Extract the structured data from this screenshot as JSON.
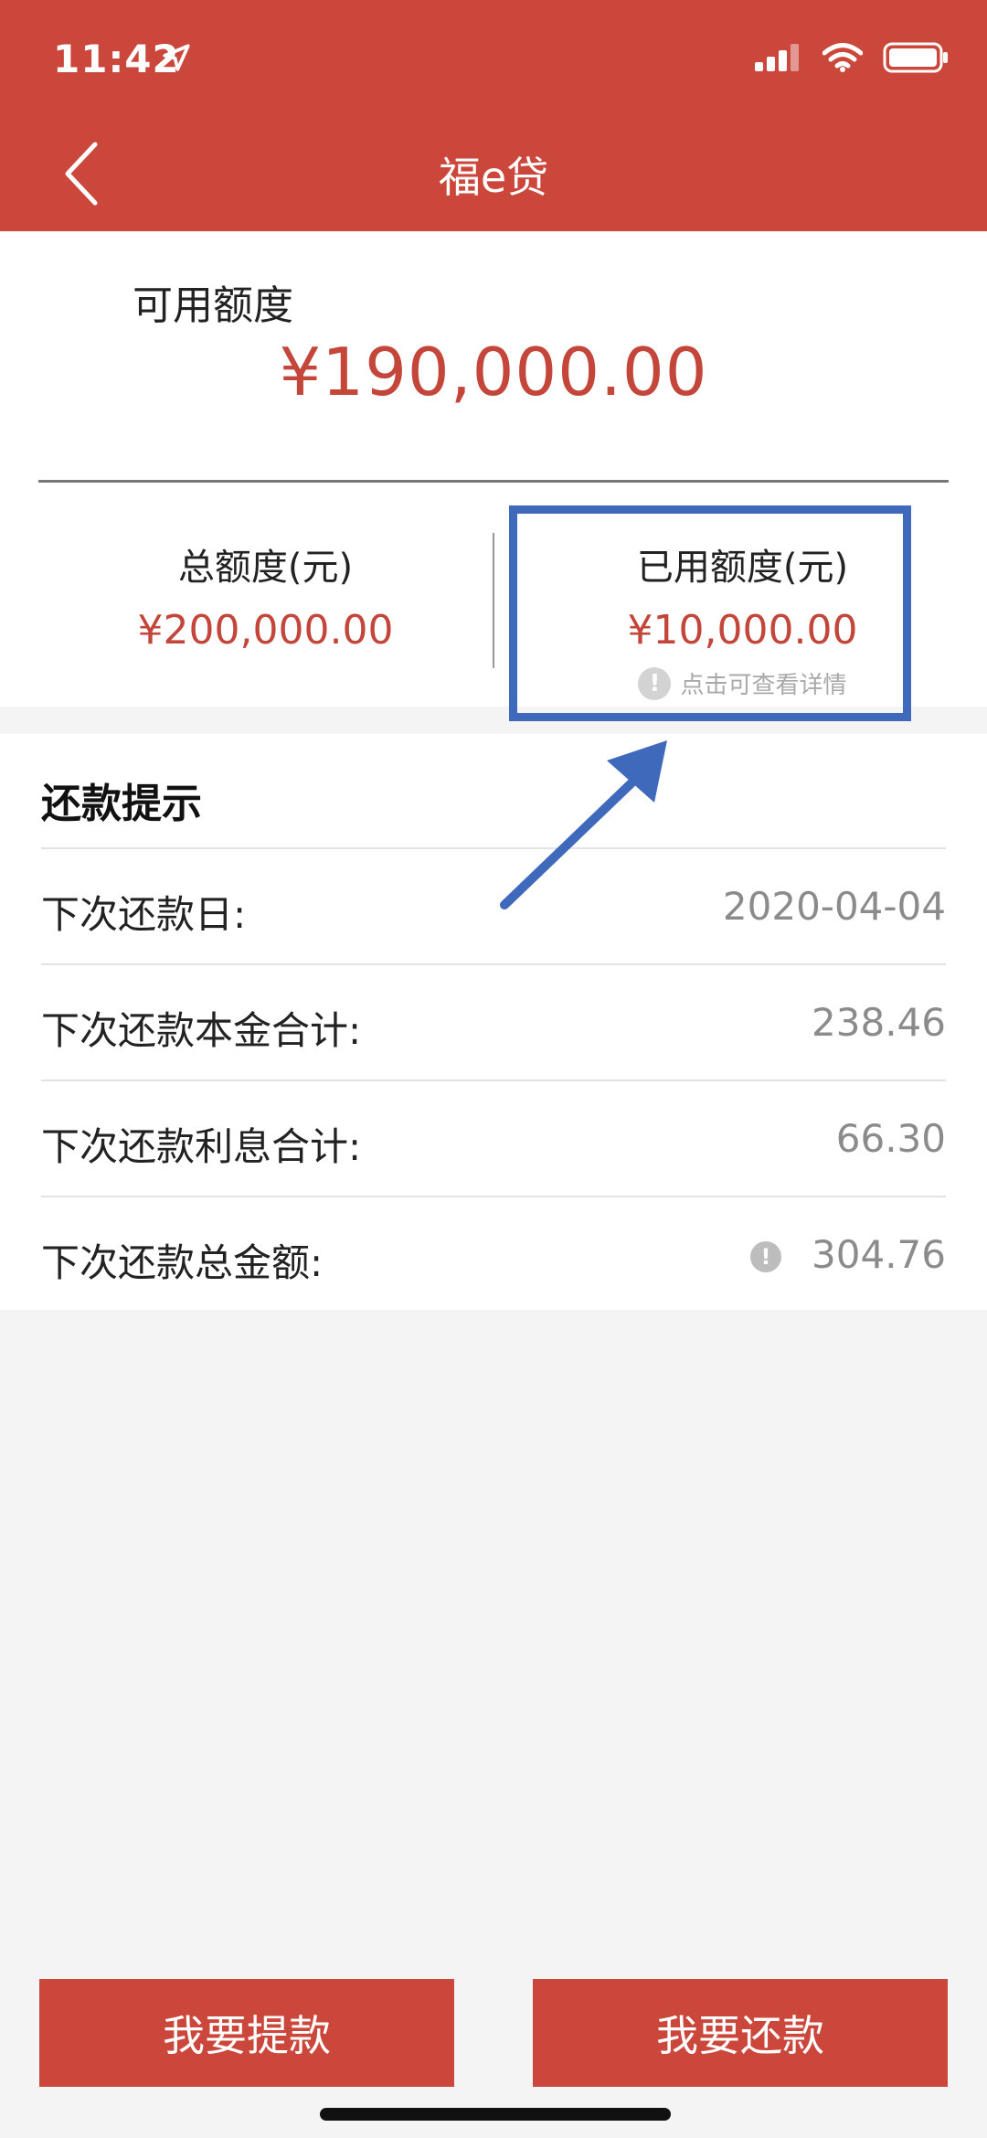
{
  "status_bar": {
    "time": "11:42",
    "icons": [
      "location-arrow-icon",
      "signal-icon",
      "wifi-icon",
      "battery-icon"
    ]
  },
  "nav": {
    "title": "福e贷",
    "back_icon": "chevron-left-icon"
  },
  "credit": {
    "available_label": "可用额度",
    "available_amount": "¥190,000.00",
    "total_label": "总额度(元)",
    "total_amount": "¥200,000.00",
    "used_label": "已用额度(元)",
    "used_amount": "¥10,000.00",
    "detail_hint": "点击可查看详情",
    "hint_icon": "!"
  },
  "repayment": {
    "title": "还款提示",
    "rows": [
      {
        "label": "下次还款日:",
        "value": "2020-04-04"
      },
      {
        "label": "下次还款本金合计:",
        "value": "238.46"
      },
      {
        "label": "下次还款利息合计:",
        "value": "66.30"
      },
      {
        "label": "下次还款总金额:",
        "value": "304.76"
      }
    ],
    "info_icon": "!"
  },
  "actions": {
    "withdraw_label": "我要提款",
    "repay_label": "我要还款"
  },
  "colors": {
    "brand_red": "#cb463b",
    "amount_red": "#c4463b",
    "annotation_blue": "#3f69bb"
  }
}
